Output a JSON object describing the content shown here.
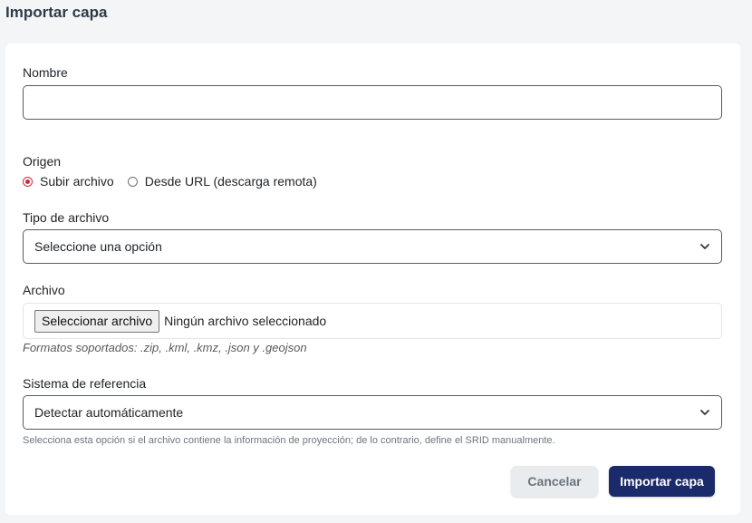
{
  "page": {
    "title": "Importar capa"
  },
  "form": {
    "name": {
      "label": "Nombre",
      "value": ""
    },
    "origin": {
      "label": "Origen",
      "options": [
        {
          "label": "Subir archivo",
          "checked": true
        },
        {
          "label": "Desde URL (descarga remota)",
          "checked": false
        }
      ]
    },
    "file_type": {
      "label": "Tipo de archivo",
      "selected": "Seleccione una opción"
    },
    "file": {
      "label": "Archivo",
      "button_label": "Seleccionar archivo",
      "status": "Ningún archivo seleccionado",
      "hint": "Formatos soportados: .zip, .kml, .kmz, .json y .geojson"
    },
    "reference_system": {
      "label": "Sistema de referencia",
      "selected": "Detectar automáticamente",
      "hint": "Selecciona esta opción si el archivo contiene la información de proyección; de lo contrario, define el SRID manualmente."
    }
  },
  "actions": {
    "cancel_label": "Cancelar",
    "submit_label": "Importar capa"
  },
  "colors": {
    "accent": "#d3273e",
    "primary_button": "#1a2a6b",
    "background": "#f4f5f7"
  },
  "icons": {
    "select_arrow": "chevron-down-icon"
  }
}
